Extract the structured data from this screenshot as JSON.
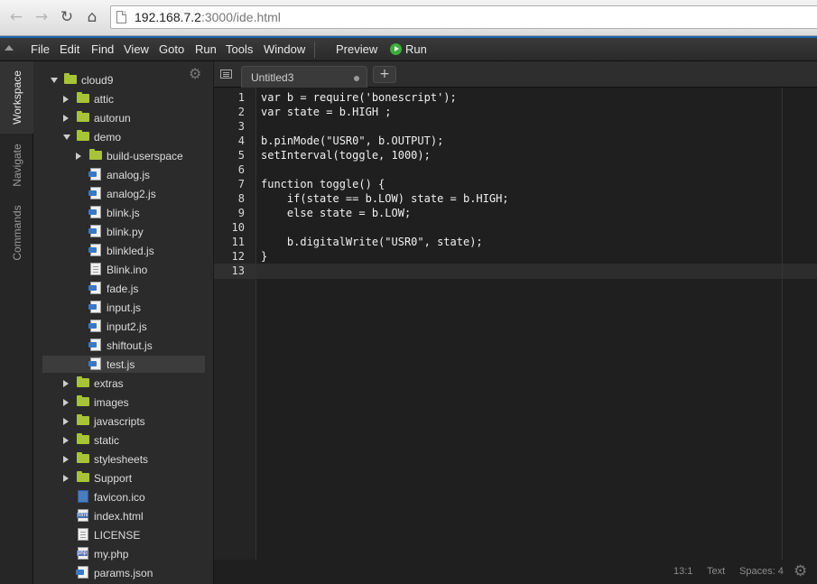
{
  "browser": {
    "url_host": "192.168.7.2",
    "url_rest": ":3000/ide.html",
    "back_icon": "←",
    "forward_icon": "→",
    "reload_icon": "↻",
    "home_icon": "⌂"
  },
  "menubar": {
    "items": [
      "File",
      "Edit",
      "Find",
      "View",
      "Goto",
      "Run",
      "Tools",
      "Window"
    ],
    "preview_label": "Preview",
    "run_label": "Run"
  },
  "side_tabs": [
    "Workspace",
    "Navigate",
    "Commands"
  ],
  "tree": {
    "gear_icon": "⚙",
    "items": [
      {
        "label": "cloud9",
        "type": "folder",
        "open": true
      },
      {
        "label": "attic",
        "type": "folder",
        "open": false
      },
      {
        "label": "autorun",
        "type": "folder",
        "open": false
      },
      {
        "label": "demo",
        "type": "folder",
        "open": true
      },
      {
        "label": "build-userspace",
        "type": "folder",
        "open": false
      },
      {
        "label": "analog.js",
        "type": "js"
      },
      {
        "label": "analog2.js",
        "type": "js"
      },
      {
        "label": "blink.js",
        "type": "js"
      },
      {
        "label": "blink.py",
        "type": "js"
      },
      {
        "label": "blinkled.js",
        "type": "js"
      },
      {
        "label": "Blink.ino",
        "type": "doc"
      },
      {
        "label": "fade.js",
        "type": "js"
      },
      {
        "label": "input.js",
        "type": "js"
      },
      {
        "label": "input2.js",
        "type": "js"
      },
      {
        "label": "shiftout.js",
        "type": "js"
      },
      {
        "label": "test.js",
        "type": "js",
        "selected": true
      },
      {
        "label": "extras",
        "type": "folder",
        "open": false
      },
      {
        "label": "images",
        "type": "folder",
        "open": false
      },
      {
        "label": "javascripts",
        "type": "folder",
        "open": false
      },
      {
        "label": "static",
        "type": "folder",
        "open": false
      },
      {
        "label": "stylesheets",
        "type": "folder",
        "open": false
      },
      {
        "label": "Support",
        "type": "folder",
        "open": false
      },
      {
        "label": "favicon.ico",
        "type": "ico"
      },
      {
        "label": "index.html",
        "type": "html"
      },
      {
        "label": "LICENSE",
        "type": "doc"
      },
      {
        "label": "my.php",
        "type": "php"
      },
      {
        "label": "params.json",
        "type": "js"
      }
    ]
  },
  "editor": {
    "tab_label": "Untitled3",
    "add_tab_label": "+",
    "lines": [
      "var b = require('bonescript');",
      "var state = b.HIGH ;",
      "",
      "b.pinMode(\"USR0\", b.OUTPUT);",
      "setInterval(toggle, 1000);",
      "",
      "function toggle() {",
      "    if(state == b.LOW) state = b.HIGH;",
      "    else state = b.LOW;",
      "",
      "    b.digitalWrite(\"USR0\", state);",
      "}",
      ""
    ]
  },
  "status": {
    "cursor": "13:1",
    "mode": "Text",
    "indent": "Spaces: 4",
    "gear_icon": "⚙"
  }
}
